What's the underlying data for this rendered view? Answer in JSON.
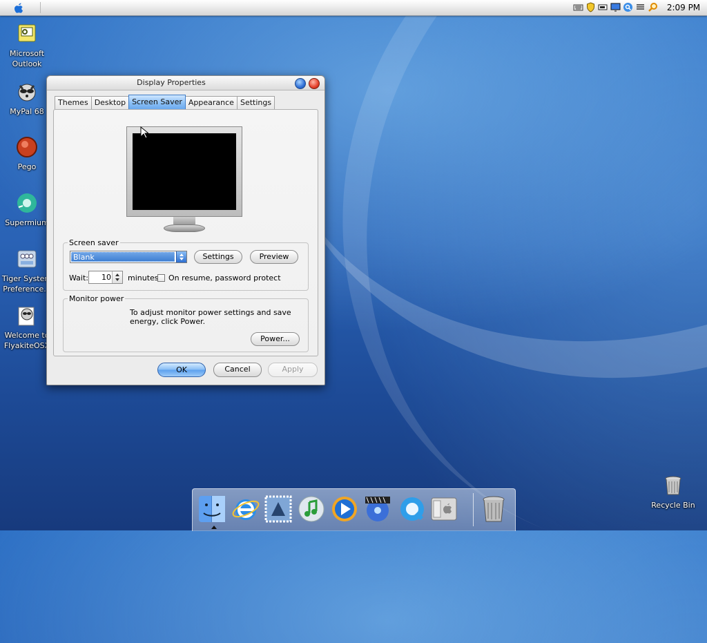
{
  "menubar": {
    "clock": "2:09 PM",
    "tray_icons": [
      "keyboard-icon",
      "shield-icon",
      "battery-icon",
      "monitor-icon",
      "search-icon",
      "network-icon",
      "spotlight-icon"
    ]
  },
  "desktop": {
    "icons": [
      {
        "label": "Microsoft Outlook",
        "icon": "outlook-icon"
      },
      {
        "label": "MyPal 68",
        "icon": "raccoon-icon"
      },
      {
        "label": "Pego",
        "icon": "pego-icon"
      },
      {
        "label": "Supermium",
        "icon": "supermium-icon"
      },
      {
        "label": "Tiger System Preference...",
        "icon": "system-preferences-icon"
      },
      {
        "label": "Welcome to FlyakiteOSX",
        "icon": "flyakite-icon"
      }
    ],
    "recycle_bin": {
      "label": "Recycle Bin",
      "icon": "trash-icon"
    }
  },
  "window": {
    "title": "Display Properties",
    "tabs": [
      {
        "label": "Themes",
        "active": false
      },
      {
        "label": "Desktop",
        "active": false
      },
      {
        "label": "Screen Saver",
        "active": true
      },
      {
        "label": "Appearance",
        "active": false
      },
      {
        "label": "Settings",
        "active": false
      }
    ],
    "screen_saver": {
      "group_label": "Screen saver",
      "selected": "Blank",
      "settings_label": "Settings",
      "preview_label": "Preview",
      "wait_label": "Wait:",
      "wait_value": "10",
      "minutes_label": "minutes",
      "password_label": "On resume, password protect",
      "password_checked": false
    },
    "monitor_power": {
      "group_label": "Monitor power",
      "description": "To adjust monitor power settings and save energy, click Power.",
      "power_label": "Power..."
    },
    "buttons": {
      "ok": "OK",
      "cancel": "Cancel",
      "apply": "Apply"
    }
  },
  "dock": {
    "items": [
      "finder-icon",
      "internet-explorer-icon",
      "mail-icon",
      "itunes-icon",
      "media-player-icon",
      "dvd-player-icon",
      "quicktime-icon",
      "boot-camp-icon",
      "trash-icon"
    ]
  },
  "colors": {
    "accent": "#5b9fee",
    "desktop": "#2a63b6"
  }
}
